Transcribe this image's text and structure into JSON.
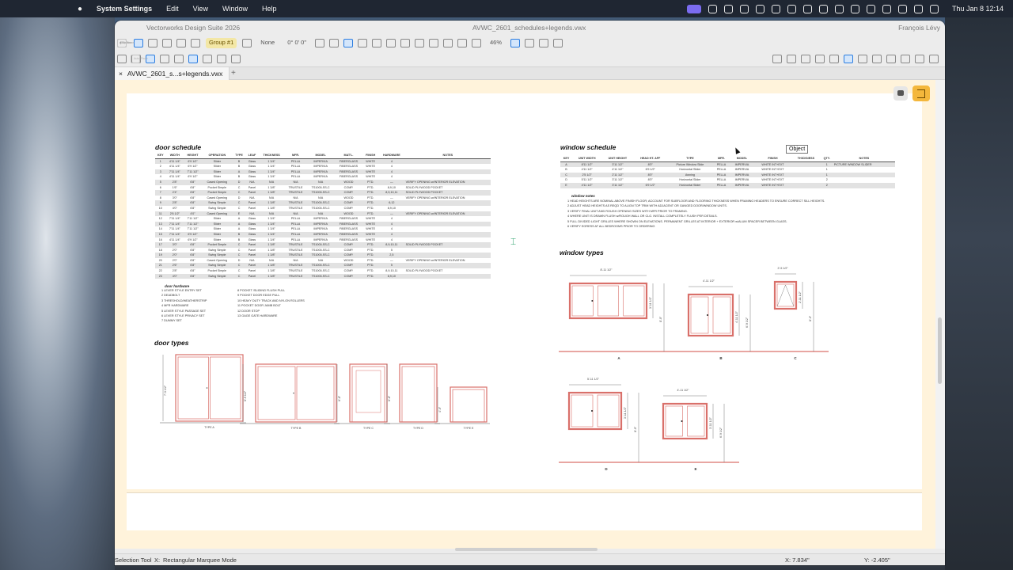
{
  "menubar": {
    "app": "System Settings",
    "items": [
      "Edit",
      "View",
      "Window",
      "Help"
    ],
    "clock": "Thu Jan 8  12:14"
  },
  "window": {
    "app_title": "Vectorworks Design Suite 2026",
    "doc_title": "AVWC_2601_schedules+legends.vwx",
    "user": "François Lévy",
    "tab_label": "AVWC_2601_s...s+legends.vwx",
    "tab_close": "×",
    "tab_add": "+"
  },
  "toolbar": {
    "view_mode": "Top/Plan",
    "plane": "2D Plan",
    "class": "Group #1",
    "render": "None",
    "wireframe": "Wireframe",
    "layer": "<None>",
    "rotation": "0° 0' 0\"",
    "zoom": "46%",
    "auto_plane": "Auto-Plane"
  },
  "status": {
    "tool": "Selection Tool",
    "x_label": "X:",
    "mode": "Rectangular Marquee Mode",
    "x_coord": "X: 7.834\"",
    "y_coord": "Y: -2.405\""
  },
  "tooltip": "Object",
  "door_schedule": {
    "title": "door schedule",
    "headers": [
      "KEY",
      "WIDTH",
      "HEIGHT",
      "OPERATION",
      "TYPE",
      "LEAF",
      "THICKNESS",
      "MFR.",
      "MODEL",
      "MAT'L.",
      "FINISH",
      "HARDWARE",
      "NOTES"
    ],
    "rows": [
      [
        "1",
        "4'11 1/4\"",
        "6'9 1/2\"",
        "Slider",
        "B",
        "Glass",
        "1 3/4\"",
        "PELLA",
        "IMPERVIA",
        "FIBERGLASS",
        "WHITE",
        "4",
        ""
      ],
      [
        "2",
        "4'11 1/4\"",
        "6'9 1/2\"",
        "Slider",
        "B",
        "Glass",
        "1 3/4\"",
        "PELLA",
        "IMPERVIA",
        "FIBERGLASS",
        "WHITE",
        "4",
        ""
      ],
      [
        "3",
        "7'11 1/4\"",
        "7'11 1/2\"",
        "Slider",
        "A",
        "Glass",
        "1 3/4\"",
        "PELLA",
        "IMPERVIA",
        "FIBERGLASS",
        "WHITE",
        "4",
        ""
      ],
      [
        "4",
        "4'11 1/4\"",
        "6'9 1/2\"",
        "Slider",
        "B",
        "Glass",
        "1 3/4\"",
        "PELLA",
        "IMPERVIA",
        "FIBERGLASS",
        "WHITE",
        "4",
        ""
      ],
      [
        "5",
        "2'8\"",
        "6'8\"",
        "Cased Opening",
        "D",
        "N/A",
        "N/A",
        "N/A",
        "N/A",
        "WOOD",
        "PTD.",
        "—",
        "VERIFY OPENING w/INTERIOR ELEVATION"
      ],
      [
        "6",
        "1'6\"",
        "6'8\"",
        "Pocket Simple",
        "C",
        "Panel",
        "1 3/8\"",
        "TRUSTILE",
        "TS1000-SS-C",
        "COMP.",
        "PTD.",
        "8,9,10",
        "SOLID PLYWOOD POCKET"
      ],
      [
        "7",
        "2'4\"",
        "6'8\"",
        "Pocket Simple",
        "C",
        "Panel",
        "1 3/8\"",
        "TRUSTILE",
        "TS1000-SS-C",
        "COMP.",
        "PTD.",
        "8,9,10,11",
        "SOLID PLYWOOD POCKET"
      ],
      [
        "8",
        "3'0\"",
        "6'8\"",
        "Cased Opening",
        "D",
        "N/A",
        "N/A",
        "N/A",
        "N/A",
        "WOOD",
        "PTD.",
        "—",
        "VERIFY OPENING w/INTERIOR ELEVATION"
      ],
      [
        "9",
        "2'8\"",
        "6'8\"",
        "Swing Simple",
        "C",
        "Panel",
        "1 3/8\"",
        "TRUSTILE",
        "TS1000-SS-C",
        "COMP.",
        "PTD.",
        "6,12",
        ""
      ],
      [
        "10",
        "4'0\"",
        "6'8\"",
        "Swing Simple",
        "C",
        "Panel",
        "1 3/8\"",
        "TRUSTILE",
        "TS1000-SS-C",
        "COMP.",
        "PTD.",
        "8,9,10",
        ""
      ],
      [
        "11",
        "2'6 1/2\"",
        "4'0\"",
        "Cased Opening",
        "E",
        "N/A",
        "N/A",
        "N/A",
        "N/A",
        "WOOD",
        "PTD.",
        "—",
        "VERIFY OPENING w/INTERIOR ELEVATION"
      ],
      [
        "12",
        "7'11 1/4\"",
        "7'11 1/2\"",
        "Slider",
        "A",
        "Glass",
        "1 3/4\"",
        "PELLA",
        "IMPERVIA",
        "FIBERGLASS",
        "WHITE",
        "4",
        ""
      ],
      [
        "13",
        "7'11 1/4\"",
        "7'11 1/2\"",
        "Slider",
        "A",
        "Glass",
        "1 3/4\"",
        "PELLA",
        "IMPERVIA",
        "FIBERGLASS",
        "WHITE",
        "4",
        ""
      ],
      [
        "14",
        "7'11 1/4\"",
        "7'11 1/2\"",
        "Slider",
        "A",
        "Glass",
        "1 3/4\"",
        "PELLA",
        "IMPERVIA",
        "FIBERGLASS",
        "WHITE",
        "4",
        ""
      ],
      [
        "15",
        "7'11 1/4\"",
        "6'9 1/2\"",
        "Slider",
        "B",
        "Glass",
        "1 3/4\"",
        "PELLA",
        "IMPERVIA",
        "FIBERGLASS",
        "WHITE",
        "4",
        ""
      ],
      [
        "16",
        "4'11 1/4\"",
        "6'9 1/2\"",
        "Slider",
        "B",
        "Glass",
        "1 3/4\"",
        "PELLA",
        "IMPERVIA",
        "FIBERGLASS",
        "WHITE",
        "4",
        ""
      ],
      [
        "17",
        "3'0\"",
        "6'8\"",
        "Pocket Simple",
        "C",
        "Panel",
        "1 3/8\"",
        "TRUSTILE",
        "TS1000-SS-C",
        "COMP.",
        "PTD.",
        "8,9,10,11",
        "SOLID PLYWOOD POCKET"
      ],
      [
        "18",
        "2'0\"",
        "6'8\"",
        "Swing Simple",
        "C",
        "Panel",
        "1 3/8\"",
        "TRUSTILE",
        "TS1000-SS-C",
        "COMP.",
        "PTD.",
        "5",
        ""
      ],
      [
        "19",
        "2'0\"",
        "6'8\"",
        "Swing Simple",
        "C",
        "Panel",
        "1 3/8\"",
        "TRUSTILE",
        "TS1000-SS-C",
        "COMP.",
        "PTD.",
        "2,5",
        ""
      ],
      [
        "20",
        "2'0\"",
        "6'8\"",
        "Cased Opening",
        "D",
        "N/A",
        "N/A",
        "N/A",
        "N/A",
        "WOOD",
        "PTD.",
        "—",
        "VERIFY OPENING w/INTERIOR ELEVATION"
      ],
      [
        "21",
        "2'6\"",
        "6'8\"",
        "Swing Simple",
        "C",
        "Panel",
        "1 3/8\"",
        "TRUSTILE",
        "TS1000-SS-C",
        "COMP.",
        "PTD.",
        "5",
        ""
      ],
      [
        "22",
        "2'8\"",
        "6'8\"",
        "Pocket Simple",
        "C",
        "Panel",
        "1 3/8\"",
        "TRUSTILE",
        "TS1000-SS-C",
        "COMP.",
        "PTD.",
        "8,9,10,11",
        "SOLID PLYWOOD POCKET"
      ],
      [
        "23",
        "4'0\"",
        "6'8\"",
        "Swing Simple",
        "C",
        "Panel",
        "1 3/8\"",
        "TRUSTILE",
        "TS1000-SS-C",
        "COMP.",
        "PTD.",
        "8,9,10",
        ""
      ]
    ]
  },
  "door_hardware": {
    "title": "door hardware",
    "col1": [
      "1  LEVER STYLE ENTRY SET",
      "2  DEADBOLT",
      "3  THRESHOLD/WEATHERSTRIP",
      "4  MFR HARDWARE",
      "5  LEVER STYLE PASSAGE SET",
      "6  LEVER STYLE PRIVACY SET",
      "7  DUMMY SET"
    ],
    "col2": [
      "8  POCKET /SLIDING FLUSH PULL",
      "9  POCKET DOOR EDGE PULL",
      "10  HEAVY DUTY TRACK AND NYLON ROLLERS",
      "11  POCKET DOOR JAMB BOLT",
      "12  DOOR STOP",
      "13  GAGE GATE HARDWARE"
    ]
  },
  "door_types": {
    "title": "door types",
    "labels": [
      "TYPE A",
      "TYPE B",
      "TYPE C",
      "TYPE D",
      "TYPE E"
    ],
    "heights": [
      "7'-3 1/2\"",
      "6'-9 1/2\"",
      "6'-8\"",
      "6'-8\"",
      "4'-0\""
    ]
  },
  "window_schedule": {
    "title": "window schedule",
    "headers": [
      "KEY",
      "UNIT WIDTH",
      "UNIT HEIGHT",
      "HEAD HT. AFF",
      "TYPE",
      "MFR.",
      "MODEL",
      "FINISH",
      "THICKNESS",
      "QTY.",
      "NOTES"
    ],
    "rows": [
      [
        "A",
        "8'11 1/2\"",
        "3'11 1/2\"",
        "8'0\"",
        "Picture Window Slide",
        "PELLA",
        "IMPERVIA",
        "WHITE INT+EXT",
        "",
        "1",
        "PICTURE WINDOW SLIDER"
      ],
      [
        "B",
        "4'11 1/2\"",
        "4'11 1/2\"",
        "6'9 1/2\"",
        "Horizontal Slider",
        "PELLA",
        "IMPERVIA",
        "WHITE INT+EXT",
        "",
        "1",
        ""
      ],
      [
        "C",
        "2'5 1/2\"",
        "2'11 1/2\"",
        "8'0\"",
        "Awning",
        "PELLA",
        "IMPERVIA",
        "WHITE INT+EXT",
        "",
        "1",
        ""
      ],
      [
        "D",
        "5'11 1/2\"",
        "3'11 1/2\"",
        "8'0\"",
        "Horizontal Slider",
        "PELLA",
        "IMPERVIA",
        "WHITE INT+EXT",
        "",
        "2",
        ""
      ],
      [
        "E",
        "4'11 1/2\"",
        "3'11 1/2\"",
        "6'9 1/2\"",
        "Horizontal Slider",
        "PELLA",
        "IMPERVIA",
        "WHITE INT+EXT",
        "",
        "2",
        ""
      ]
    ]
  },
  "window_notes": {
    "title": "window notes",
    "items": [
      "1  HEAD HEIGHTS ARE NOMINAL ABOVE FINISH FLOOR; ACCOUNT FOR SUBFLOOR AND FLOORING THICKNESS WHEN FRAMING HEADERS TO ENSURE CORRECT SILL HEIGHTS.",
      "2  ADJUST HEAD HEIGHTS AS REQD TO ALIGN TOP TRIM WITH ADJACENT OR GANGED DOOR/WINDOW UNITS.",
      "3  VERIFY FINAL UNIT AND ROUGH OPENING SIZES WITH MFR PRIOR TO FRAMING.",
      "4  WHERE UNIT IS DRAWN FLUSH w/ROUGH WALL OR CLG. INSTALL COMPLETELY FLUSH PER DETAILS.",
      "5  FULL DIVIDED LIGHT GRILLES WHERE SHOWN ON ELEVATIONS. PERMANENT GRILLES AT INTERIOR + EXTERIOR w/ALUM SPACER BETWEEN GLASS.",
      "6  VERIFY EGRESS AT ALL BEDROOMS PRIOR TO ORDERING"
    ]
  },
  "window_types": {
    "title": "window types",
    "labels": [
      "A",
      "B",
      "C",
      "D",
      "E"
    ],
    "widths": [
      "8'-11 1/2\"",
      "4'-11 1/2\"",
      "2'-5 1/2\"",
      "5'-11 1/2\"",
      "4'-11 1/2\""
    ],
    "heights": [
      "3'-11 1/2\"",
      "4'-11 1/2\"",
      "2'-11 1/2\"",
      "3'-11 1/2\"",
      "3'-11 1/2\""
    ],
    "head_heights": [
      "8'-0\"",
      "6'-9 1/2\"",
      "8'-0\"",
      "8'-0\"",
      "6'-9 1/2\""
    ]
  },
  "colors": {
    "frame": "#d9706a",
    "canvas_bg": "#fff3db",
    "group_highlight": "#f3e7a6",
    "accent": "#2b7de0"
  }
}
